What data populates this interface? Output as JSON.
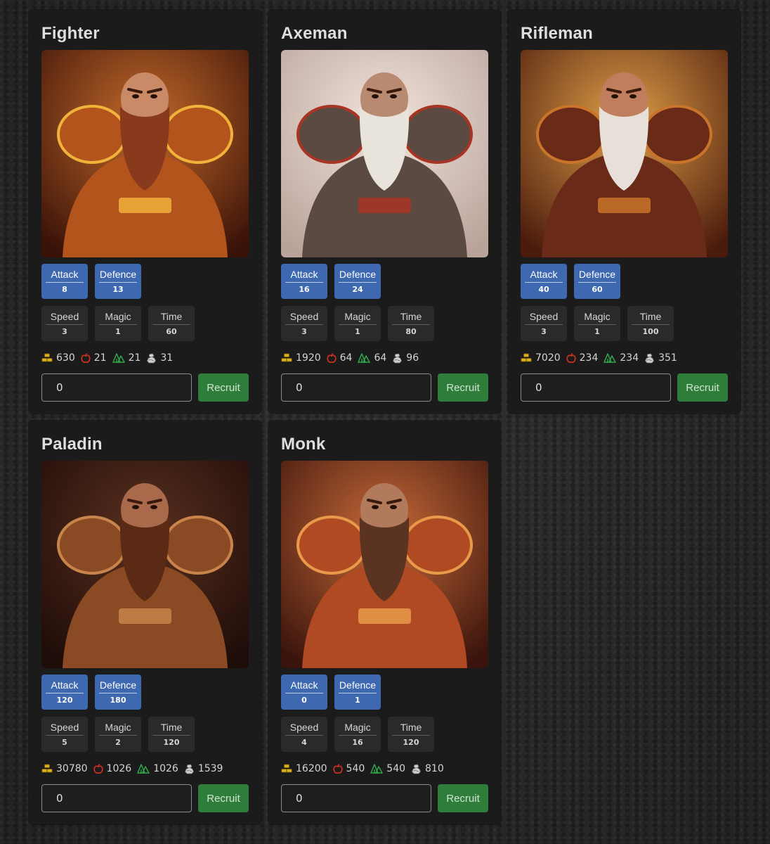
{
  "units": [
    {
      "name": "Fighter",
      "image": "fighter-portrait",
      "stats": {
        "attack": "8",
        "defence": "13",
        "speed": "3",
        "magic": "1",
        "time": "60"
      },
      "costs": {
        "gold": "630",
        "food": "21",
        "wood": "21",
        "stone": "31"
      },
      "quantity": "0"
    },
    {
      "name": "Axeman",
      "image": "axeman-portrait",
      "stats": {
        "attack": "16",
        "defence": "24",
        "speed": "3",
        "magic": "1",
        "time": "80"
      },
      "costs": {
        "gold": "1920",
        "food": "64",
        "wood": "64",
        "stone": "96"
      },
      "quantity": "0"
    },
    {
      "name": "Rifleman",
      "image": "rifleman-portrait",
      "stats": {
        "attack": "40",
        "defence": "60",
        "speed": "3",
        "magic": "1",
        "time": "100"
      },
      "costs": {
        "gold": "7020",
        "food": "234",
        "wood": "234",
        "stone": "351"
      },
      "quantity": "0"
    },
    {
      "name": "Paladin",
      "image": "paladin-portrait",
      "stats": {
        "attack": "120",
        "defence": "180",
        "speed": "5",
        "magic": "2",
        "time": "120"
      },
      "costs": {
        "gold": "30780",
        "food": "1026",
        "wood": "1026",
        "stone": "1539"
      },
      "quantity": "0"
    },
    {
      "name": "Monk",
      "image": "monk-portrait",
      "stats": {
        "attack": "0",
        "defence": "1",
        "speed": "4",
        "magic": "16",
        "time": "120"
      },
      "costs": {
        "gold": "16200",
        "food": "540",
        "wood": "540",
        "stone": "810"
      },
      "quantity": "0"
    }
  ],
  "labels": {
    "attack": "Attack",
    "defence": "Defence",
    "speed": "Speed",
    "magic": "Magic",
    "time": "Time",
    "recruit": "Recruit"
  },
  "icons": {
    "gold": "gold-bars-icon",
    "food": "apple-icon",
    "wood": "trees-icon",
    "stone": "stone-icon"
  },
  "colors": {
    "primary_stat": "#3e68b0",
    "recruit": "#2f7d3b",
    "gold": "#d9b021",
    "food": "#d8321e",
    "wood": "#2fa84a",
    "stone": "#d8d8d8"
  }
}
